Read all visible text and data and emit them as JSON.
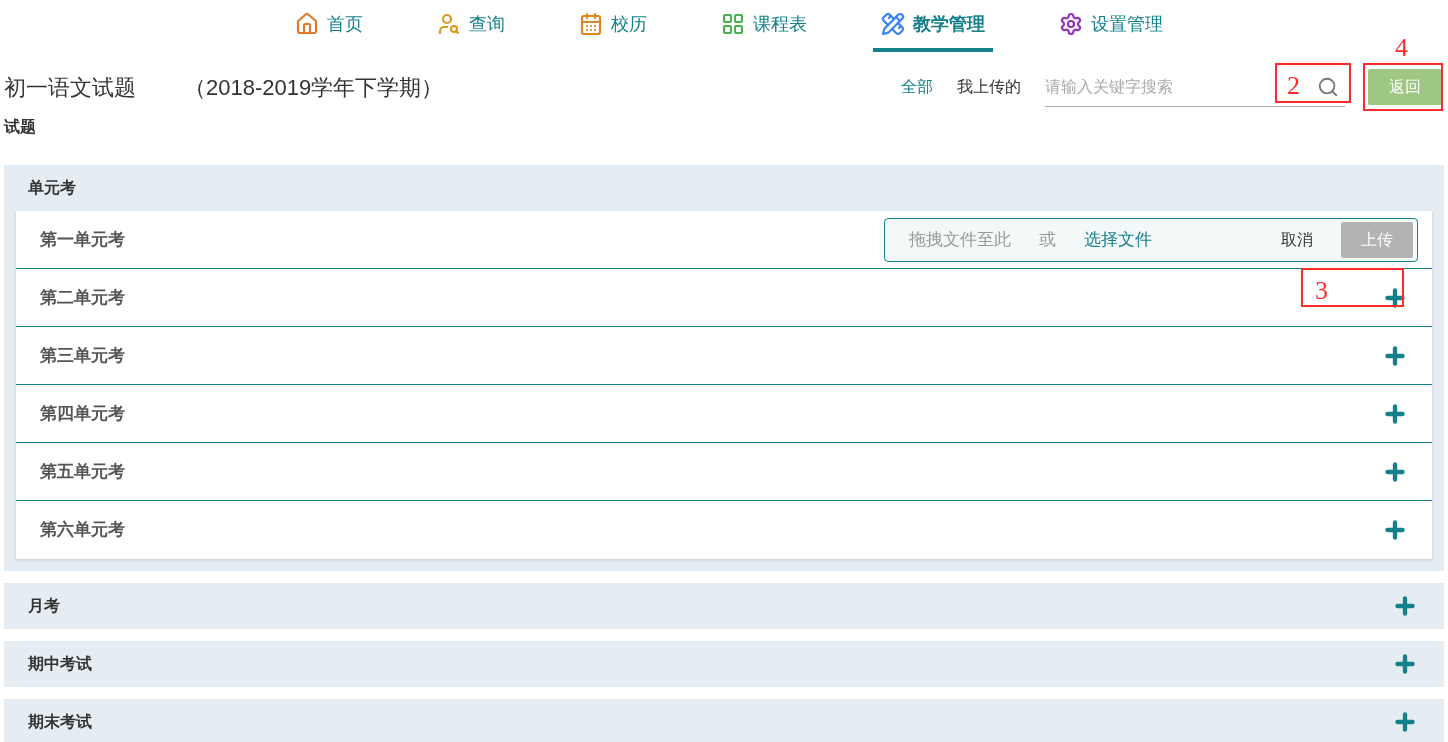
{
  "nav": [
    {
      "label": "首页",
      "selected": false
    },
    {
      "label": "查询",
      "selected": false
    },
    {
      "label": "校历",
      "selected": false
    },
    {
      "label": "课程表",
      "selected": false
    },
    {
      "label": "教学管理",
      "selected": true
    },
    {
      "label": "设置管理",
      "selected": false
    }
  ],
  "page": {
    "title": "初一语文试题",
    "term": "（2018-2019学年下学期）",
    "subtitle": "试题"
  },
  "filters": [
    {
      "label": "全部",
      "selected": true
    },
    {
      "label": "我上传的",
      "selected": false
    }
  ],
  "search": {
    "placeholder": "请输入关键字搜索",
    "annotation": "2"
  },
  "back_button": {
    "label": "返回",
    "annotation": "4"
  },
  "sections": [
    {
      "title": "单元考",
      "expanded": true,
      "items": [
        {
          "kind": "upload",
          "title": "第一单元考",
          "drop_hint": "拖拽文件至此",
          "or": "或",
          "choose": "选择文件",
          "cancel": "取消",
          "upload": "上传"
        },
        {
          "kind": "collapsed",
          "title": "第二单元考",
          "annotation": "3"
        },
        {
          "kind": "collapsed",
          "title": "第三单元考"
        },
        {
          "kind": "collapsed",
          "title": "第四单元考"
        },
        {
          "kind": "collapsed",
          "title": "第五单元考"
        },
        {
          "kind": "collapsed",
          "title": "第六单元考"
        }
      ]
    },
    {
      "title": "月考",
      "expanded": false
    },
    {
      "title": "期中考试",
      "expanded": false
    },
    {
      "title": "期末考试",
      "expanded": false
    }
  ]
}
